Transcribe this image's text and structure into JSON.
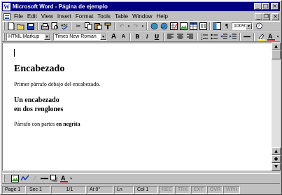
{
  "window": {
    "title": "Microsoft Word - Página de ejemplo",
    "app_icon": "W"
  },
  "menu": {
    "items": [
      "File",
      "Edit",
      "View",
      "Insert",
      "Format",
      "Tools",
      "Table",
      "Window",
      "Help"
    ]
  },
  "toolbar": {
    "zoom": "100%",
    "style": "HTML Markup",
    "font": "Times New Roman",
    "bold_label": "B",
    "italic_label": "I",
    "underline_label": "U"
  },
  "document": {
    "heading1": "Encabezado",
    "paragraph1": "Primer párrafo debajo del encabezado.",
    "heading2_line1": "Un encabezado",
    "heading2_line2": "en dos renglones",
    "paragraph2_normal": "Párrafo con partes ",
    "paragraph2_bold": "en negrita"
  },
  "status": {
    "page": "Page 1",
    "sec": "Sec 1",
    "pages": "1/1",
    "at": "At  0\"",
    "ln": "Ln",
    "col": "Col 1",
    "rec": "REC",
    "trk": "TRK",
    "ext": "EXT",
    "ovr": "OVR",
    "wph": "WPH"
  }
}
